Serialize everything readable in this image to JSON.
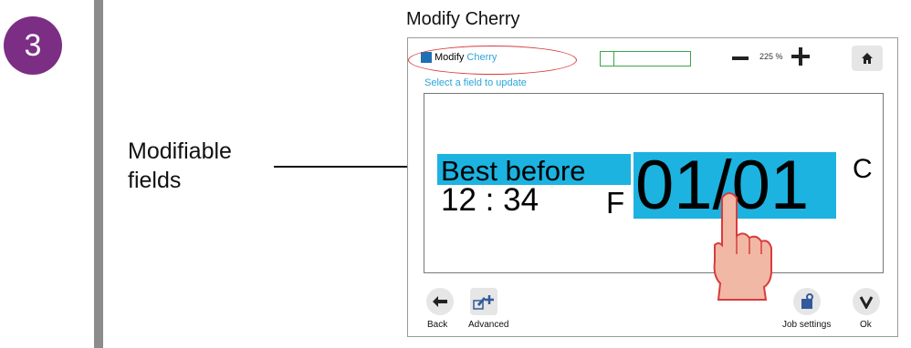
{
  "step": {
    "number": "3",
    "color": "#7b2e84"
  },
  "callout": {
    "line1": "Modifiable",
    "line2": "fields"
  },
  "figure": {
    "title": "Modify Cherry"
  },
  "screen": {
    "header": {
      "title_prefix": "Modify",
      "title_highlight": "Cherry",
      "title_color": "#2aa6d9",
      "ink_gauge_fraction": 0.15,
      "zoom_label": "225 %",
      "home_icon": "home-icon"
    },
    "hint": "Select a field to update",
    "label_preview": {
      "field_best_before": "Best before",
      "field_date": "01/01",
      "time_text": "12 : 34",
      "f_text": "F",
      "c_text": "C",
      "highlight_color": "#1cb3e0"
    },
    "footer": {
      "back_label": "Back",
      "advanced_label": "Advanced",
      "job_settings_label": "Job settings",
      "ok_label": "Ok"
    }
  }
}
